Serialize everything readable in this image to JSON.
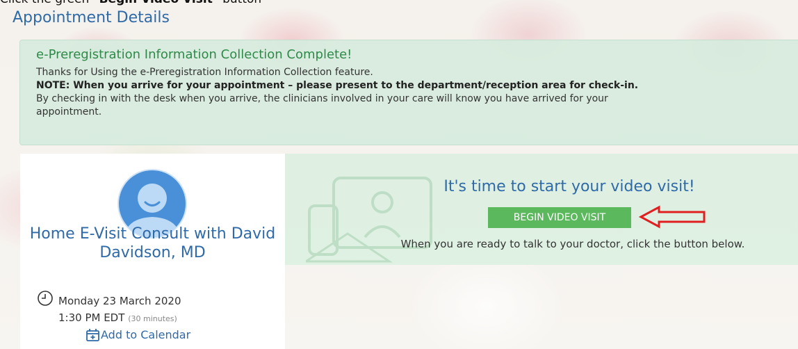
{
  "instruction": {
    "prefix": "Click the green ",
    "emphasis": "\"Begin Video Visit\"",
    "suffix": " button"
  },
  "page_title": "Appointment Details",
  "alert": {
    "title": "e-Preregistration Information Collection Complete!",
    "line1": "Thanks for Using the e-Preregistration Information Collection feature.",
    "note": "NOTE: When you arrive for your appointment – please present to the department/reception area for check-in.",
    "line3": "By checking in with the desk when you arrive, the clinicians involved in your care will know you have arrived for your",
    "line4": "appointment."
  },
  "appointment": {
    "title": "Home E-Visit Consult with David Davidson, MD",
    "date": "Monday 23 March 2020",
    "time": "1:30 PM EDT",
    "duration": "(30 minutes)",
    "add_to_calendar": "Add to Calendar"
  },
  "video_visit": {
    "heading": "It's time to start your video visit!",
    "button_label": "BEGIN VIDEO VISIT",
    "hint": "When you are ready to talk to your doctor, click the button below."
  },
  "colors": {
    "accent_blue": "#2f6aa8",
    "success_green": "#5cb85c",
    "alert_title_green": "#2d8a48",
    "annotation_red": "#e02020"
  },
  "icons": {
    "avatar": "user-avatar-icon",
    "clock": "clock-icon",
    "calendar": "calendar-add-icon",
    "annotation": "red-arrow-icon"
  }
}
